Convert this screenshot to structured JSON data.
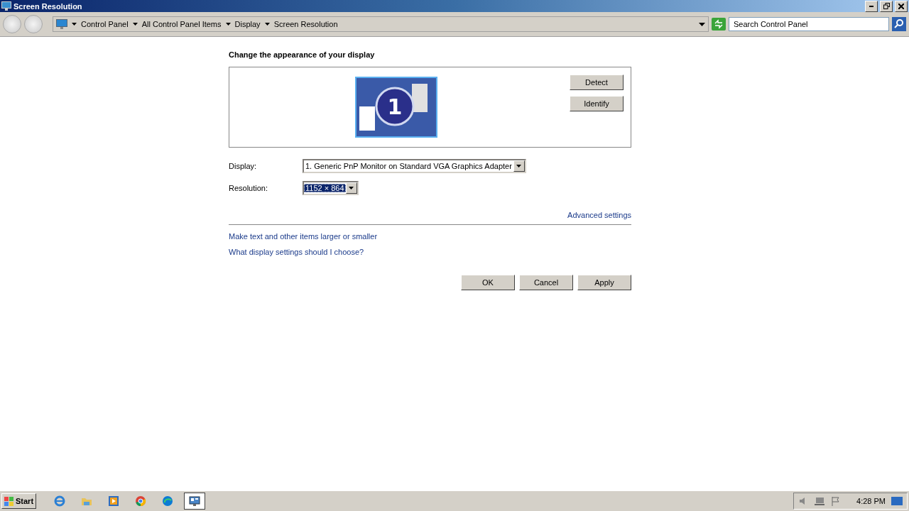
{
  "window": {
    "title": "Screen Resolution"
  },
  "address_bar": {
    "breadcrumbs": [
      "Control Panel",
      "All Control Panel Items",
      "Display",
      "Screen Resolution"
    ],
    "search": {
      "placeholder": "Search Control Panel"
    }
  },
  "heading": "Change the appearance of your display",
  "monitor_preview": {
    "number": "1",
    "buttons": [
      "Detect",
      "Identify"
    ]
  },
  "fields": [
    {
      "label": "Display:",
      "value": "1. Generic PnP Monitor on Standard VGA Graphics Adapter",
      "focused": false
    },
    {
      "label": "Resolution:",
      "value": "1152 × 864",
      "focused": true
    }
  ],
  "advanced_link": "Advanced settings",
  "links": [
    "Make text and other items larger or smaller",
    "What display settings should I choose?"
  ],
  "dialog_buttons": [
    "OK",
    "Cancel",
    "Apply"
  ],
  "taskbar": {
    "start": "Start",
    "apps": [
      {
        "kind": "ie",
        "selected": false
      },
      {
        "kind": "folder",
        "selected": false
      },
      {
        "kind": "media",
        "selected": false
      },
      {
        "kind": "chrome",
        "selected": false
      },
      {
        "kind": "edge",
        "selected": false
      },
      {
        "kind": "display",
        "selected": true
      }
    ],
    "clock": "4:28 PM"
  }
}
